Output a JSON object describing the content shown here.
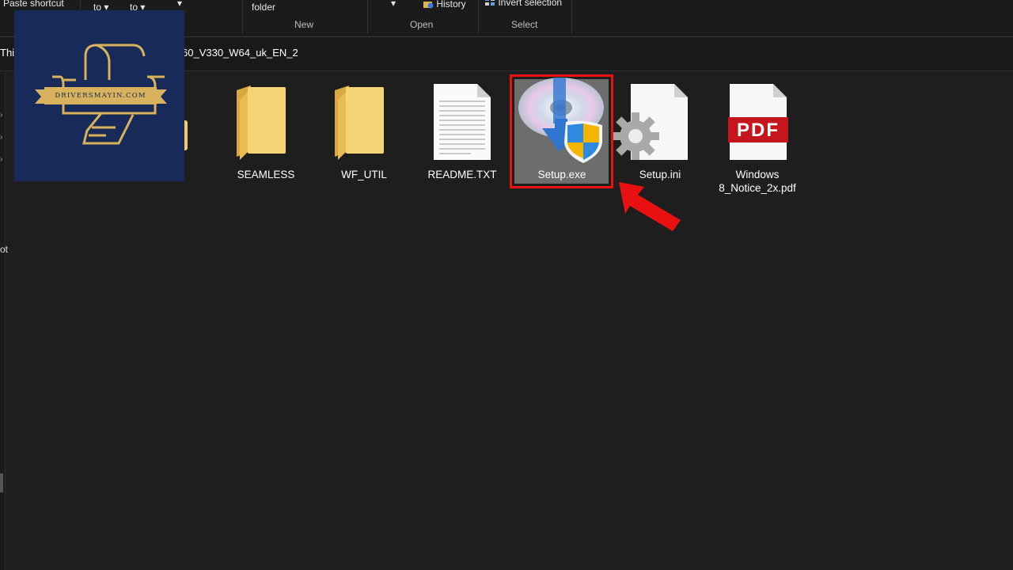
{
  "ribbon": {
    "paste_shortcut": "Paste shortcut",
    "move_to": "to",
    "copy_to": "to",
    "new_folder": "folder",
    "history": "History",
    "invert_selection": "Invert selection",
    "groups": {
      "new": "New",
      "open": "Open",
      "select": "Select"
    }
  },
  "address": {
    "prefix": "This",
    "path_tail": "60_V330_W64_uk_EN_2"
  },
  "navpane": {
    "fragment": "ot"
  },
  "files": [
    {
      "name": "SEAMLESS",
      "type": "folder"
    },
    {
      "name": "WF_UTIL",
      "type": "folder"
    },
    {
      "name": "README.TXT",
      "type": "text-document"
    },
    {
      "name": "Setup.exe",
      "type": "installer",
      "selected": true
    },
    {
      "name": "Setup.ini",
      "type": "config-file"
    },
    {
      "name": "Windows 8_Notice_2x.pdf",
      "type": "pdf",
      "line1": "Windows",
      "line2": "8_Notice_2x.pdf",
      "badge": "PDF"
    }
  ],
  "watermark": {
    "text": "DRIVERSMAYIN.COM"
  },
  "colors": {
    "highlight_border": "#e81010",
    "pointer_arrow": "#e81010",
    "logo_bg": "#172a59",
    "logo_gold": "#d8b25c"
  }
}
